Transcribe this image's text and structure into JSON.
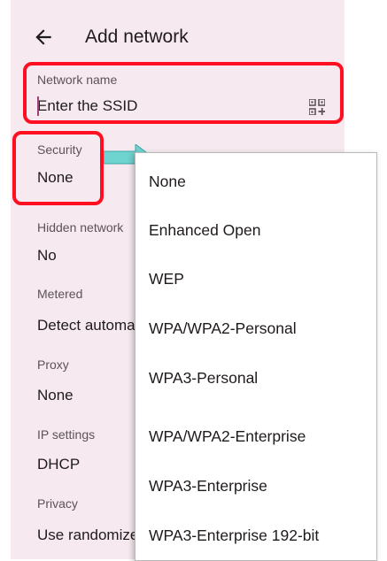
{
  "header": {
    "title": "Add network"
  },
  "network_name": {
    "label": "Network name",
    "placeholder": "Enter the SSID"
  },
  "security": {
    "label": "Security",
    "value": "None"
  },
  "hidden_network": {
    "label": "Hidden network",
    "value": "No"
  },
  "metered": {
    "label": "Metered",
    "value": "Detect automat"
  },
  "proxy": {
    "label": "Proxy",
    "value": "None"
  },
  "ip_settings": {
    "label": "IP settings",
    "value": "DHCP"
  },
  "privacy": {
    "label": "Privacy",
    "value": "Use randomize"
  },
  "security_options": [
    "None",
    "Enhanced Open",
    "WEP",
    "WPA/WPA2-Personal",
    "WPA3-Personal",
    "WPA/WPA2-Enterprise",
    "WPA3-Enterprise",
    "WPA3-Enterprise 192-bit"
  ],
  "icons": {
    "back": "arrow-left-icon",
    "scan": "qr-code-scan-icon"
  },
  "colors": {
    "background": "#f6eaf0",
    "highlight": "#ff0f1f",
    "arrow": "#6fd3d0",
    "caret": "#a1437a"
  }
}
